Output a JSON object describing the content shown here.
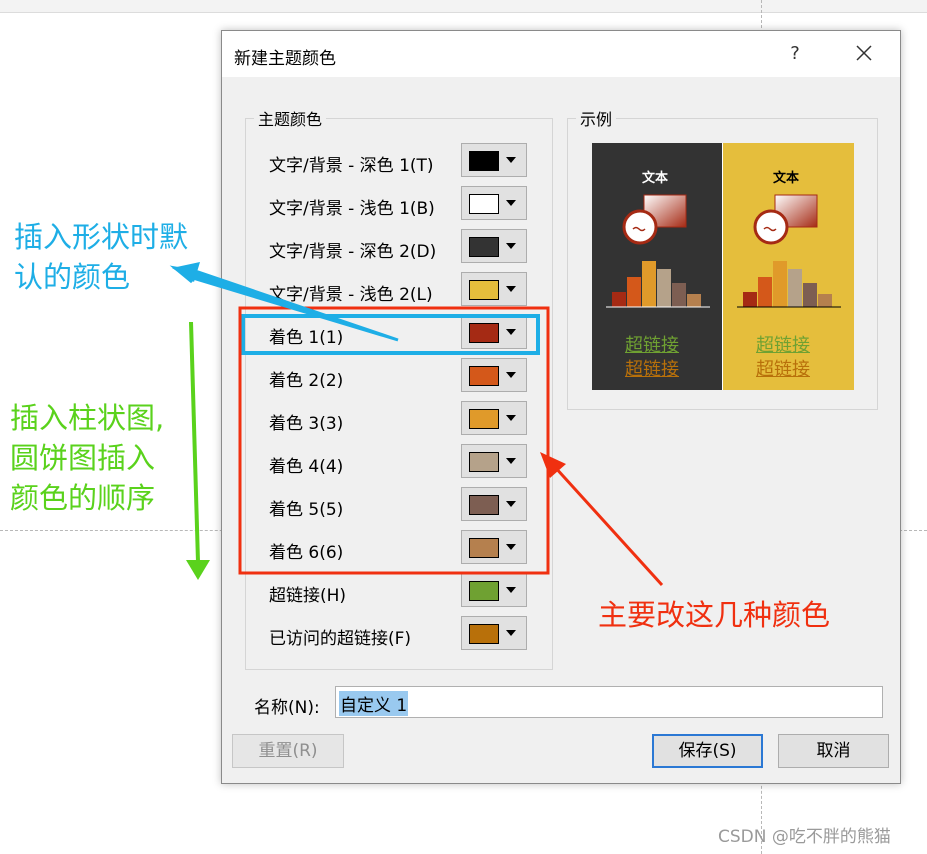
{
  "dialog": {
    "title": "新建主题颜色",
    "help_label": "?",
    "theme_colors_legend": "主题颜色",
    "sample_legend": "示例",
    "rows": [
      {
        "label": "文字/背景 - 深色 1(T)",
        "color": "#000000"
      },
      {
        "label": "文字/背景 - 浅色 1(B)",
        "color": "#ffffff"
      },
      {
        "label": "文字/背景 - 深色 2(D)",
        "color": "#333333"
      },
      {
        "label": "文字/背景 - 浅色 2(L)",
        "color": "#e5be3c"
      },
      {
        "label": "着色 1(1)",
        "color": "#a52a14"
      },
      {
        "label": "着色 2(2)",
        "color": "#d4581a"
      },
      {
        "label": "着色 3(3)",
        "color": "#e09a2a"
      },
      {
        "label": "着色 4(4)",
        "color": "#b5a28a"
      },
      {
        "label": "着色 5(5)",
        "color": "#7d5e52"
      },
      {
        "label": "着色 6(6)",
        "color": "#b5804e"
      },
      {
        "label": "超链接(H)",
        "color": "#6fa132"
      },
      {
        "label": "已访问的超链接(F)",
        "color": "#b8700a"
      }
    ],
    "name_label": "名称(N):",
    "name_value": "自定义 1",
    "reset_label": "重置(R)",
    "save_label": "保存(S)",
    "cancel_label": "取消"
  },
  "sample": {
    "text_label": "文本",
    "link_label": "超链接",
    "visited_link_label": "超链接",
    "dark_bg": "#333333",
    "light_bg": "#e5be3c"
  },
  "annotations": {
    "blue_text_line1": "插入形状时默",
    "blue_text_line2": "认的颜色",
    "green_text_line1": "插入柱状图,",
    "green_text_line2": "圆饼图插入",
    "green_text_line3": "颜色的顺序",
    "red_text": "主要改这几种颜色"
  },
  "watermark": "CSDN @吃不胖的熊猫"
}
